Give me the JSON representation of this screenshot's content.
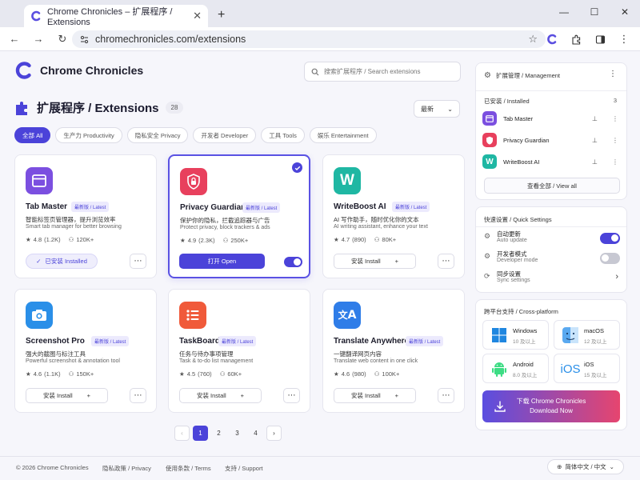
{
  "browser": {
    "tab_title": "Chrome Chronicles – 扩展程序 / Extensions",
    "url": "chromechronicles.com/extensions"
  },
  "header": {
    "brand": "Chrome Chronicles",
    "search_placeholder": "搜索扩展程序 / Search extensions",
    "page_title": "扩展程序 / Extensions",
    "count": "28",
    "sort_label": "最新"
  },
  "filters": [
    {
      "label": "全部 All",
      "active": true
    },
    {
      "label": "生产力 Productivity",
      "active": false
    },
    {
      "label": "隐私安全 Privacy",
      "active": false
    },
    {
      "label": "开发者 Developer",
      "active": false
    },
    {
      "label": "工具 Tools",
      "active": false
    },
    {
      "label": "娱乐 Entertainment",
      "active": false
    }
  ],
  "cards": [
    {
      "name": "Tab Master",
      "tag": "最新版 / Latest",
      "desc_cn": "智能标签页管理器，提升浏览效率",
      "desc_en": "Smart tab manager for better browsing",
      "rating": "4.8",
      "reviews": "(1.2K)",
      "users": "120K+",
      "action": "已安装 Installed",
      "color": "#7b4fe0"
    },
    {
      "name": "Privacy Guardian",
      "tag": "最新版 / Latest",
      "desc_cn": "保护你的隐私，拦截追踪器与广告",
      "desc_en": "Protect privacy, block trackers & ads",
      "rating": "4.9",
      "reviews": "(2.3K)",
      "users": "250K+",
      "action": "打开 Open",
      "color": "#e8405d"
    },
    {
      "name": "WriteBoost AI",
      "tag": "最新版 / Latest",
      "desc_cn": "AI 写作助手，随时优化你的文本",
      "desc_en": "AI writing assistant, enhance your text",
      "rating": "4.7",
      "reviews": "(890)",
      "users": "80K+",
      "action": "安装 Install",
      "color": "#1fb7a3"
    },
    {
      "name": "Screenshot Pro",
      "tag": "最新版 / Latest",
      "desc_cn": "强大的截图与标注工具",
      "desc_en": "Powerful screenshot & annotation tool",
      "rating": "4.6",
      "reviews": "(1.1K)",
      "users": "150K+",
      "action": "安装 Install",
      "color": "#2a8fe8"
    },
    {
      "name": "TaskBoard",
      "tag": "最新版 / Latest",
      "desc_cn": "任务与待办事项管理",
      "desc_en": "Task & to-do list management",
      "rating": "4.5",
      "reviews": "(760)",
      "users": "60K+",
      "action": "安装 Install",
      "color": "#f05a3a"
    },
    {
      "name": "Translate Anywhere",
      "tag": "最新版 / Latest",
      "desc_cn": "一键翻译网页内容",
      "desc_en": "Translate web content in one click",
      "rating": "4.6",
      "reviews": "(980)",
      "users": "100K+",
      "action": "安装 Install",
      "color": "#2f7de8"
    }
  ],
  "pagination": {
    "pages": [
      "1",
      "2",
      "3",
      "4"
    ],
    "current": "1"
  },
  "management": {
    "title": "扩展管理 / Management",
    "installed_label": "已安装 / Installed",
    "installed_count": "3",
    "items": [
      "Tab Master",
      "Privacy Guardian",
      "WriteBoost AI"
    ],
    "view_all": "查看全部 / View all"
  },
  "quick_settings": {
    "title": "快速设置 / Quick Settings",
    "items": [
      {
        "label_cn": "自动更新",
        "label_en": "Auto update",
        "state": "on"
      },
      {
        "label_cn": "开发者模式",
        "label_en": "Developer mode",
        "state": "off"
      },
      {
        "label_cn": "同步设置",
        "label_en": "Sync settings",
        "state": "link"
      }
    ]
  },
  "platforms": {
    "title": "跨平台支持 / Cross-platform",
    "items": [
      {
        "name": "Windows",
        "version": "10 及以上"
      },
      {
        "name": "macOS",
        "version": "12 及以上"
      },
      {
        "name": "Android",
        "version": "8.0 及以上"
      },
      {
        "name": "iOS",
        "version": "15 及以上"
      }
    ],
    "download_cn": "下载 Chrome Chronicles",
    "download_en": "Download Now"
  },
  "footer": {
    "copyright": "© 2026 Chrome Chronicles",
    "privacy": "隐私政策 / Privacy",
    "terms": "使用条款 / Terms",
    "support": "支持 / Support",
    "language": "简体中文 / 中文"
  },
  "colors": {
    "accent": "#4b43d9",
    "download_start": "#5a4ee0",
    "download_end": "#e6456f"
  }
}
